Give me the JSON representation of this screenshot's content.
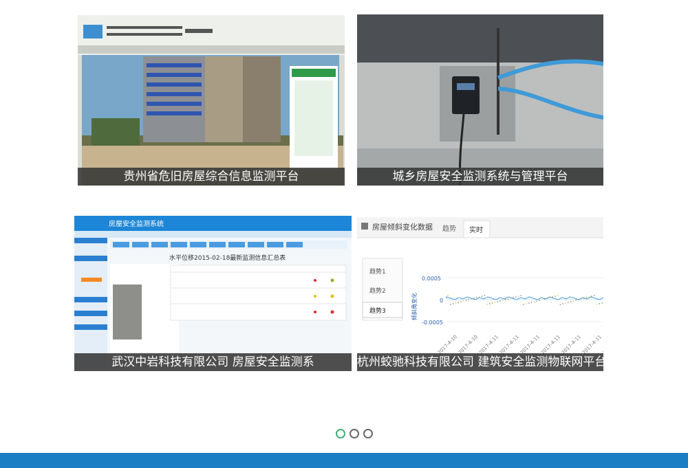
{
  "cards": [
    {
      "caption": "贵州省危旧房屋综合信息监测平台"
    },
    {
      "caption": "城乡房屋安全监测系统与管理平台"
    },
    {
      "caption": "武汉中岩科技有限公司 房屋安全监测系",
      "inner_title": "房屋安全监测系统",
      "inner_table_title": "水平位移2015-02-18最新监测信息汇总表"
    },
    {
      "caption": "杭州蛟驰科技有限公司 建筑安全监测物联网平台",
      "inner_title": "房屋倾斜变化数据",
      "tabs": [
        "趋势",
        "实时"
      ],
      "side_items": [
        "趋势1",
        "趋势2",
        "趋势3"
      ],
      "y_ticks": [
        "0.0005",
        "0",
        "-0.0005"
      ],
      "y_label": "倾斜角变化",
      "x_ticks": [
        "2017-4-10",
        "2017-4-10",
        "2017-4-11",
        "2017-4-11",
        "2017-4-11",
        "2017-4-11",
        "2017-4-11",
        "2017-4-11",
        "2017-4-1"
      ]
    }
  ],
  "carousel": {
    "count": 3,
    "active": 0
  },
  "colors": {
    "footer": "#1a7ec4",
    "caption_bg": "#373737",
    "dot_active": "#3fae7a"
  }
}
